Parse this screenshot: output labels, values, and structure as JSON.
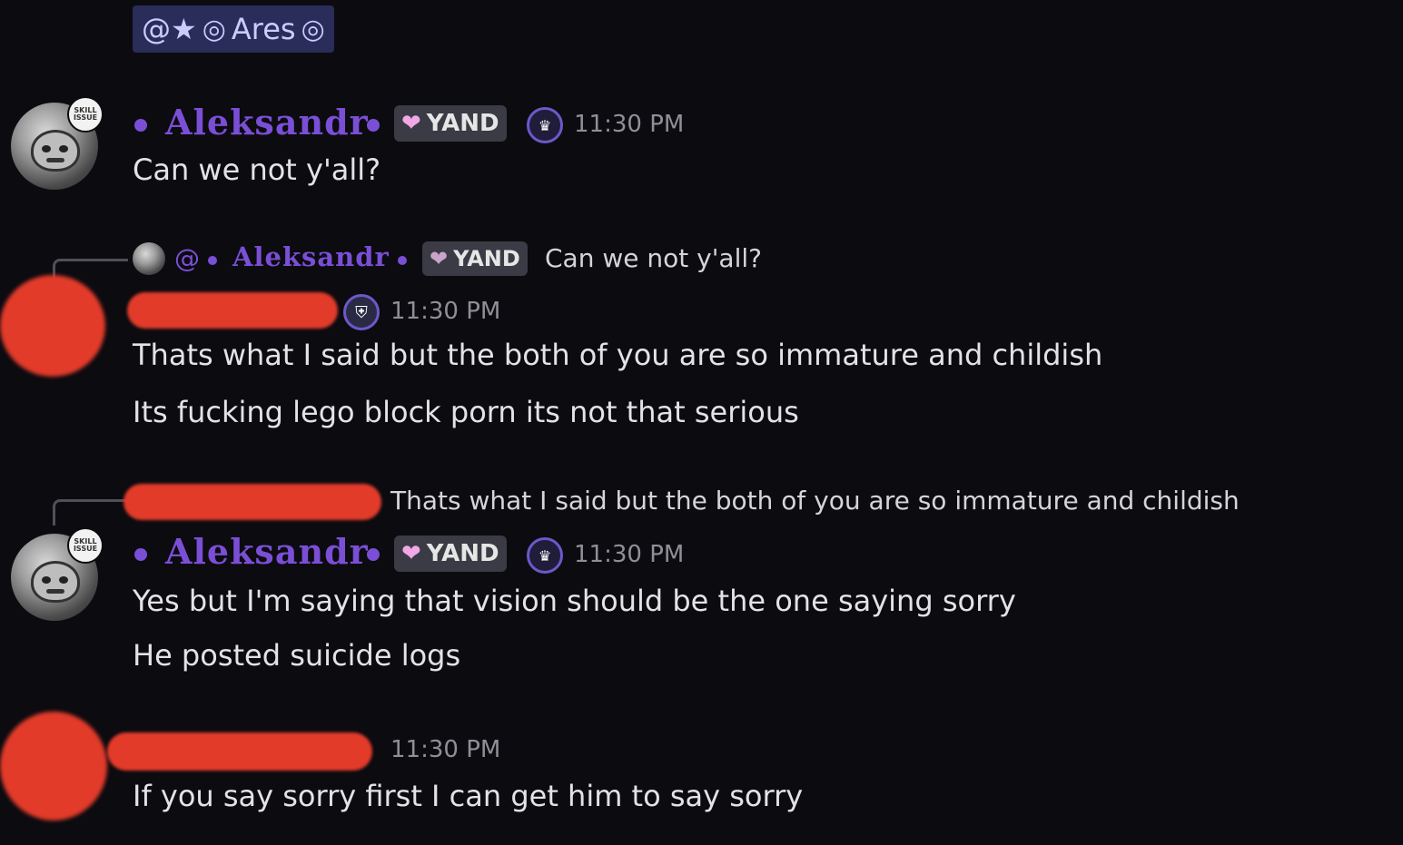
{
  "mention": {
    "prefix": "@★",
    "swirl": "◎",
    "name": "Ares",
    "swirl_end": "◎"
  },
  "messages": [
    {
      "author": "Aleksandr",
      "tag": "YAND",
      "time": "11:30 PM",
      "lines": [
        "Can we not y'all?"
      ]
    },
    {
      "reply_to": {
        "prefix": "@",
        "author": "Aleksandr",
        "tag": "YAND",
        "text": "Can we not y'all?"
      },
      "author_redacted": true,
      "time": "11:30 PM",
      "lines": [
        "Thats what I said but the both of you are so immature and childish",
        "Its fucking lego block porn its not that serious"
      ]
    },
    {
      "reply_to": {
        "author_redacted": true,
        "text": "Thats what I said but the both of you are so immature and childish"
      },
      "author": "Aleksandr",
      "tag": "YAND",
      "time": "11:30 PM",
      "lines": [
        "Yes but I'm saying that vision should be the one saying sorry",
        "He posted suicide logs"
      ]
    },
    {
      "author_redacted": true,
      "time": "11:30 PM",
      "lines": [
        "If you say sorry first I can get him to say sorry"
      ]
    }
  ],
  "icons": {
    "heart": "heart-icon",
    "crown": "crown-badge-icon",
    "shield": "shield-badge-icon"
  },
  "colors": {
    "background": "#0c0b10",
    "username": "#7a4fd6",
    "redaction": "#e23b2a",
    "mention_bg": "#2a2c5a"
  }
}
